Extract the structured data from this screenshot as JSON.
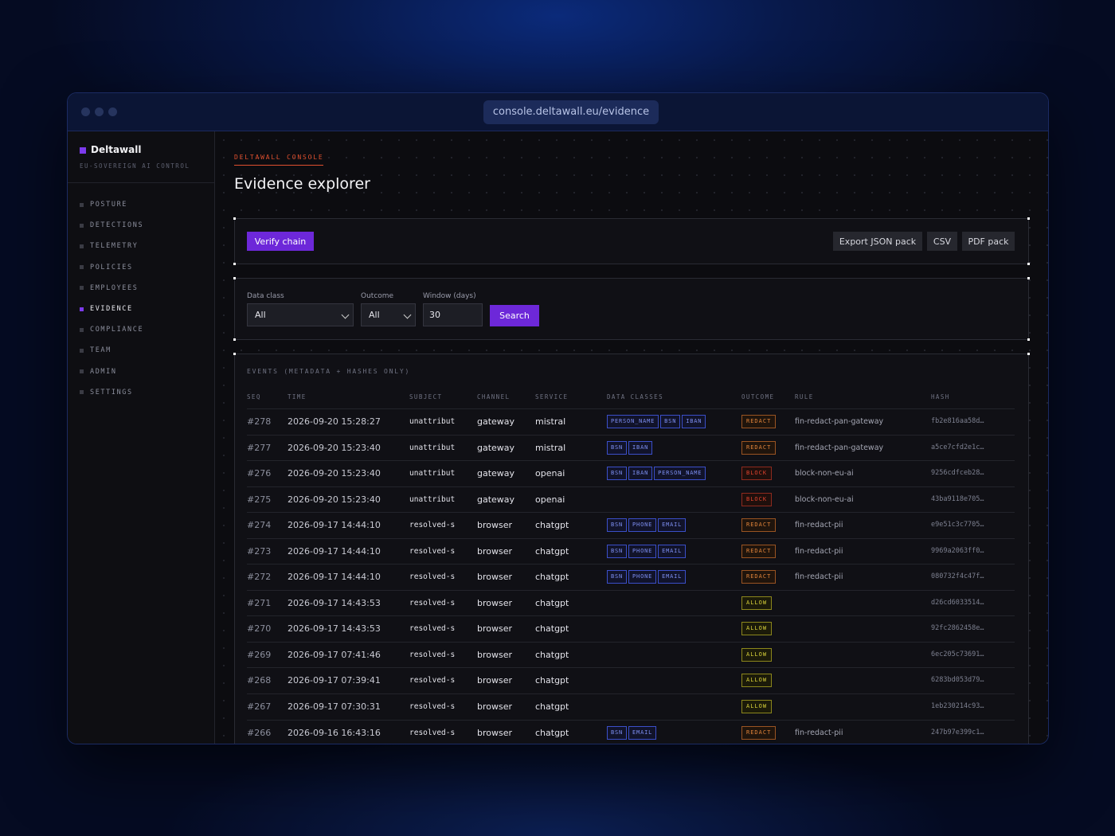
{
  "browser": {
    "url": "console.deltawall.eu/evidence"
  },
  "sidebar": {
    "brand": "Deltawall",
    "tagline": "EU-SOVEREIGN AI CONTROL",
    "items": [
      {
        "label": "POSTURE",
        "active": false
      },
      {
        "label": "DETECTIONS",
        "active": false
      },
      {
        "label": "TELEMETRY",
        "active": false
      },
      {
        "label": "POLICIES",
        "active": false
      },
      {
        "label": "EMPLOYEES",
        "active": false
      },
      {
        "label": "EVIDENCE",
        "active": true
      },
      {
        "label": "COMPLIANCE",
        "active": false
      },
      {
        "label": "TEAM",
        "active": false
      },
      {
        "label": "ADMIN",
        "active": false
      },
      {
        "label": "SETTINGS",
        "active": false
      }
    ]
  },
  "header": {
    "eyebrow": "DELTAWALL CONSOLE",
    "title": "Evidence explorer"
  },
  "actions": {
    "verify_label": "Verify chain",
    "export_json_label": "Export JSON pack",
    "csv_label": "CSV",
    "pdf_label": "PDF pack"
  },
  "filters": {
    "data_class": {
      "label": "Data class",
      "value": "All"
    },
    "outcome": {
      "label": "Outcome",
      "value": "All"
    },
    "window": {
      "label": "Window (days)",
      "value": "30"
    },
    "search_label": "Search"
  },
  "table": {
    "title": "EVENTS (METADATA + HASHES ONLY)",
    "columns": [
      "SEQ",
      "TIME",
      "SUBJECT",
      "CHANNEL",
      "SERVICE",
      "DATA CLASSES",
      "OUTCOME",
      "RULE",
      "HASH"
    ],
    "rows": [
      {
        "seq": "#278",
        "time": "2026-09-20 15:28:27",
        "subject": "unattribut",
        "channel": "gateway",
        "service": "mistral",
        "classes": [
          "PERSON_NAME",
          "BSN",
          "IBAN"
        ],
        "outcome": "REDACT",
        "rule": "fin-redact-pan-gateway",
        "hash": "fb2e816aa58d…"
      },
      {
        "seq": "#277",
        "time": "2026-09-20 15:23:40",
        "subject": "unattribut",
        "channel": "gateway",
        "service": "mistral",
        "classes": [
          "BSN",
          "IBAN"
        ],
        "outcome": "REDACT",
        "rule": "fin-redact-pan-gateway",
        "hash": "a5ce7cfd2e1c…"
      },
      {
        "seq": "#276",
        "time": "2026-09-20 15:23:40",
        "subject": "unattribut",
        "channel": "gateway",
        "service": "openai",
        "classes": [
          "BSN",
          "IBAN",
          "PERSON_NAME"
        ],
        "outcome": "BLOCK",
        "rule": "block-non-eu-ai",
        "hash": "9256cdfceb28…"
      },
      {
        "seq": "#275",
        "time": "2026-09-20 15:23:40",
        "subject": "unattribut",
        "channel": "gateway",
        "service": "openai",
        "classes": [],
        "outcome": "BLOCK",
        "rule": "block-non-eu-ai",
        "hash": "43ba9118e705…"
      },
      {
        "seq": "#274",
        "time": "2026-09-17 14:44:10",
        "subject": "resolved-s",
        "channel": "browser",
        "service": "chatgpt",
        "classes": [
          "BSN",
          "PHONE",
          "EMAIL"
        ],
        "outcome": "REDACT",
        "rule": "fin-redact-pii",
        "hash": "e9e51c3c7705…"
      },
      {
        "seq": "#273",
        "time": "2026-09-17 14:44:10",
        "subject": "resolved-s",
        "channel": "browser",
        "service": "chatgpt",
        "classes": [
          "BSN",
          "PHONE",
          "EMAIL"
        ],
        "outcome": "REDACT",
        "rule": "fin-redact-pii",
        "hash": "9969a2063ff0…"
      },
      {
        "seq": "#272",
        "time": "2026-09-17 14:44:10",
        "subject": "resolved-s",
        "channel": "browser",
        "service": "chatgpt",
        "classes": [
          "BSN",
          "PHONE",
          "EMAIL"
        ],
        "outcome": "REDACT",
        "rule": "fin-redact-pii",
        "hash": "080732f4c47f…"
      },
      {
        "seq": "#271",
        "time": "2026-09-17 14:43:53",
        "subject": "resolved-s",
        "channel": "browser",
        "service": "chatgpt",
        "classes": [],
        "outcome": "ALLOW",
        "rule": "",
        "hash": "d26cd6033514…"
      },
      {
        "seq": "#270",
        "time": "2026-09-17 14:43:53",
        "subject": "resolved-s",
        "channel": "browser",
        "service": "chatgpt",
        "classes": [],
        "outcome": "ALLOW",
        "rule": "",
        "hash": "92fc2862458e…"
      },
      {
        "seq": "#269",
        "time": "2026-09-17 07:41:46",
        "subject": "resolved-s",
        "channel": "browser",
        "service": "chatgpt",
        "classes": [],
        "outcome": "ALLOW",
        "rule": "",
        "hash": "6ec205c73691…"
      },
      {
        "seq": "#268",
        "time": "2026-09-17 07:39:41",
        "subject": "resolved-s",
        "channel": "browser",
        "service": "chatgpt",
        "classes": [],
        "outcome": "ALLOW",
        "rule": "",
        "hash": "6283bd053d79…"
      },
      {
        "seq": "#267",
        "time": "2026-09-17 07:30:31",
        "subject": "resolved-s",
        "channel": "browser",
        "service": "chatgpt",
        "classes": [],
        "outcome": "ALLOW",
        "rule": "",
        "hash": "1eb230214c93…"
      },
      {
        "seq": "#266",
        "time": "2026-09-16 16:43:16",
        "subject": "resolved-s",
        "channel": "browser",
        "service": "chatgpt",
        "classes": [
          "BSN",
          "EMAIL"
        ],
        "outcome": "REDACT",
        "rule": "fin-redact-pii",
        "hash": "247b97e399c1…"
      }
    ]
  },
  "colors": {
    "accent": "#6d28d9",
    "eyebrow": "#e0502e",
    "redact": "#e0833a",
    "block": "#e0432e",
    "allow": "#d8d13a",
    "tag": "#7d8ff2"
  }
}
